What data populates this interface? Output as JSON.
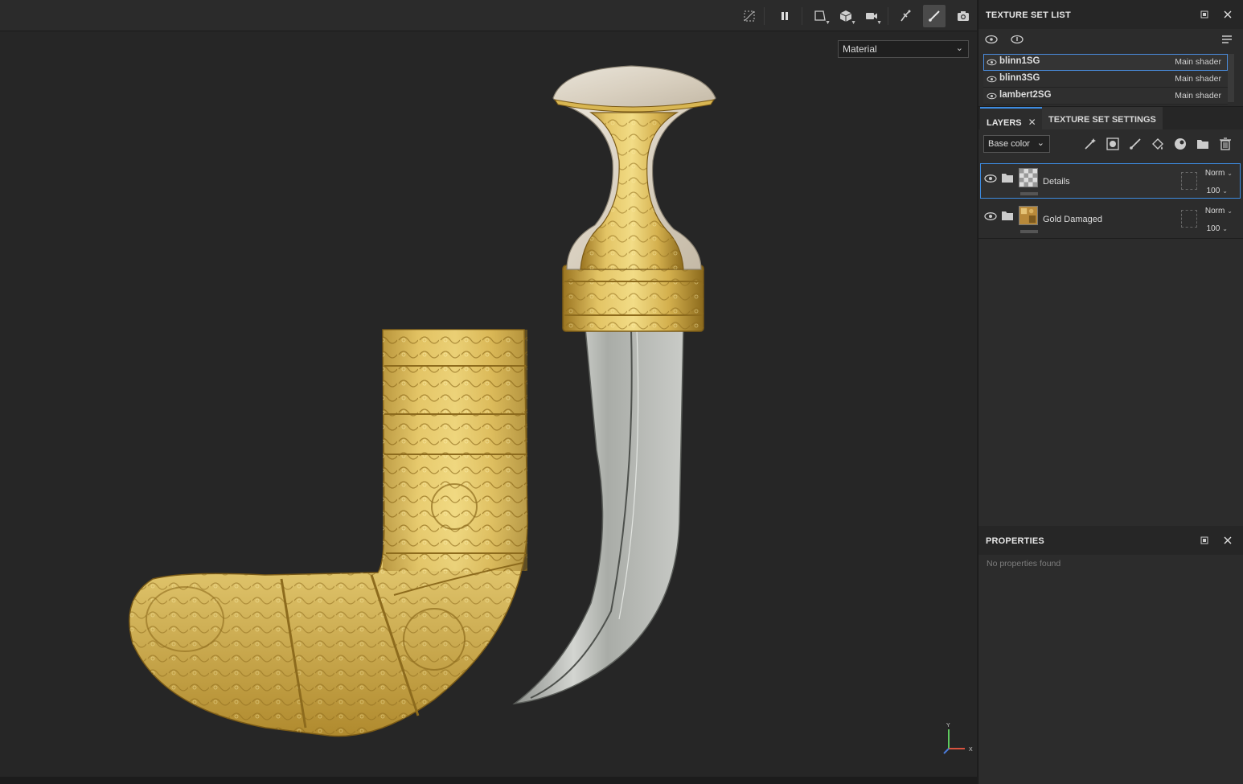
{
  "viewport": {
    "mode": "Material",
    "axis": {
      "y": "Y",
      "x": "X"
    },
    "toolbar": [
      {
        "name": "hide-ui-icon"
      },
      {
        "name": "pause-icon"
      },
      {
        "name": "view-mode-icon"
      },
      {
        "name": "cube-icon"
      },
      {
        "name": "camera-icon"
      },
      {
        "name": "symmetry-icon"
      },
      {
        "name": "brush-icon"
      },
      {
        "name": "screenshot-icon"
      }
    ]
  },
  "texture_set_list": {
    "title": "TEXTURE SET LIST",
    "items": [
      {
        "name": "blinn1SG",
        "shader": "Main shader",
        "selected": true
      },
      {
        "name": "blinn3SG",
        "shader": "Main shader",
        "selected": false
      },
      {
        "name": "lambert2SG",
        "shader": "Main shader",
        "selected": false
      }
    ]
  },
  "tabs": {
    "layers": "LAYERS",
    "close": "✕",
    "settings": "TEXTURE SET SETTINGS"
  },
  "layers": {
    "channel": "Base color",
    "items": [
      {
        "name": "Details",
        "blend": "Norm",
        "opacity": "100",
        "selected": true
      },
      {
        "name": "Gold Damaged",
        "blend": "Norm",
        "opacity": "100",
        "selected": false
      }
    ]
  },
  "properties": {
    "title": "PROPERTIES",
    "empty": "No properties found"
  },
  "colors": {
    "accent": "#3d8be0",
    "gold": "#c9a646",
    "steel": "#b7b9b5"
  }
}
